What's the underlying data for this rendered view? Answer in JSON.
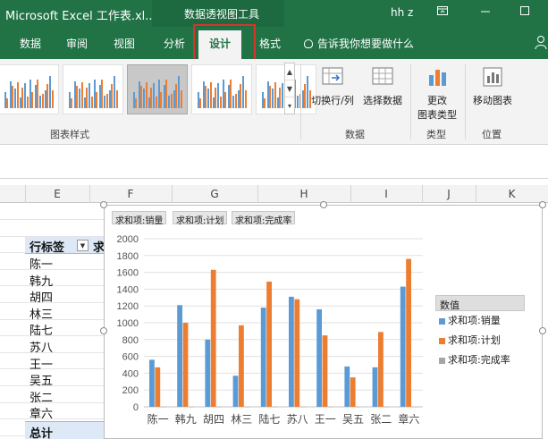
{
  "titlebar": {
    "title": "Microsoft Excel 工作表.xl...",
    "context_tool": "数据透视图工具",
    "user": "hh z",
    "accent": "#217346"
  },
  "tabs": [
    {
      "label": "数据"
    },
    {
      "label": "审阅"
    },
    {
      "label": "视图"
    },
    {
      "label": "分析"
    },
    {
      "label": "设计",
      "active": true
    },
    {
      "label": "格式"
    }
  ],
  "tellme": "告诉我你想要做什么",
  "ribbon": {
    "groups": {
      "styles": "图表样式",
      "data": "数据",
      "type": "类型",
      "location": "位置"
    },
    "buttons": {
      "switch_row_col": "切换行/列",
      "select_data": "选择数据",
      "change_type_line1": "更改",
      "change_type_line2": "图表类型",
      "move_chart": "移动图表"
    }
  },
  "columns": [
    "E",
    "F",
    "G",
    "H",
    "I",
    "J",
    "K"
  ],
  "pivot": {
    "row_label": "行标签",
    "next_col_partial": "求",
    "rows": [
      "陈一",
      "韩九",
      "胡四",
      "林三",
      "陆七",
      "苏八",
      "王一",
      "吴五",
      "张二",
      "章六"
    ],
    "total": "总计"
  },
  "chart_fields": [
    "求和项:销量",
    "求和项:计划",
    "求和项:完成率"
  ],
  "chart_data": {
    "type": "bar",
    "categories": [
      "陈一",
      "韩九",
      "胡四",
      "林三",
      "陆七",
      "苏八",
      "王一",
      "吴五",
      "张二",
      "章六"
    ],
    "series": [
      {
        "name": "求和项:销量",
        "color": "#5b9bd5",
        "values": [
          560,
          1210,
          800,
          370,
          1180,
          1310,
          1160,
          480,
          470,
          1430
        ]
      },
      {
        "name": "求和项:计划",
        "color": "#ed7d31",
        "values": [
          470,
          1000,
          1630,
          970,
          1490,
          1280,
          850,
          350,
          890,
          1760
        ]
      },
      {
        "name": "求和项:完成率",
        "color": "#a5a5a5",
        "values": [
          1.2,
          1.2,
          0.5,
          0.4,
          0.8,
          1.0,
          1.4,
          1.4,
          0.5,
          0.8
        ]
      }
    ],
    "yticks": [
      "0",
      "200",
      "400",
      "600",
      "800",
      "1000",
      "1200",
      "1400",
      "1600",
      "1800",
      "2000"
    ],
    "ylim": [
      0,
      2000
    ],
    "grid": true,
    "legend_title": "数值",
    "legend_position": "right"
  }
}
